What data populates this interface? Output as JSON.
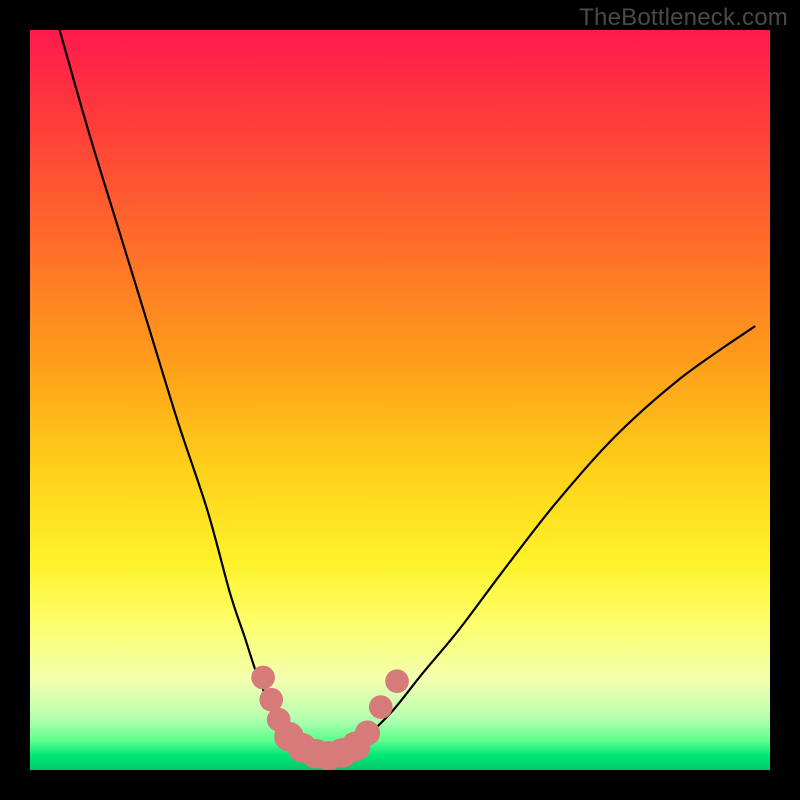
{
  "watermark": "TheBottleneck.com",
  "chart_data": {
    "type": "line",
    "title": "",
    "xlabel": "",
    "ylabel": "",
    "xlim": [
      0,
      100
    ],
    "ylim": [
      0,
      100
    ],
    "gradient_bands": [
      {
        "pos": 0,
        "color": "#ff1a4d"
      },
      {
        "pos": 12,
        "color": "#ff3b3b"
      },
      {
        "pos": 28,
        "color": "#ff6a2a"
      },
      {
        "pos": 45,
        "color": "#ff9e1a"
      },
      {
        "pos": 60,
        "color": "#ffd21a"
      },
      {
        "pos": 72,
        "color": "#fff22a"
      },
      {
        "pos": 80,
        "color": "#fdff6a"
      },
      {
        "pos": 88,
        "color": "#f2ffb0"
      },
      {
        "pos": 93,
        "color": "#b6ffb0"
      },
      {
        "pos": 96,
        "color": "#5eff90"
      },
      {
        "pos": 98,
        "color": "#00e878"
      },
      {
        "pos": 100,
        "color": "#00c86a"
      }
    ],
    "series": [
      {
        "name": "left-branch",
        "stroke": "#000000",
        "stroke_width": 2.2,
        "x": [
          4,
          8,
          12,
          16,
          20,
          24,
          27,
          29,
          31,
          33,
          35
        ],
        "y": [
          100,
          86,
          73,
          60,
          47,
          35,
          24,
          18,
          12,
          8,
          4
        ]
      },
      {
        "name": "right-branch",
        "stroke": "#000000",
        "stroke_width": 2.2,
        "x": [
          45,
          49,
          53,
          58,
          64,
          71,
          79,
          88,
          98
        ],
        "y": [
          4,
          8,
          13,
          19,
          27,
          36,
          45,
          53,
          60
        ]
      },
      {
        "name": "valley-floor",
        "stroke": "#000000",
        "stroke_width": 2.2,
        "x": [
          35,
          37,
          40,
          43,
          45
        ],
        "y": [
          4,
          2.2,
          1.6,
          2.2,
          4
        ]
      }
    ],
    "markers": [
      {
        "name": "valley-marker-chain",
        "color": "#d77a7a",
        "points": [
          {
            "x": 31.5,
            "y": 12.5,
            "r": 1.6
          },
          {
            "x": 32.6,
            "y": 9.5,
            "r": 1.6
          },
          {
            "x": 33.6,
            "y": 6.8,
            "r": 1.6
          },
          {
            "x": 35.0,
            "y": 4.5,
            "r": 2.0
          },
          {
            "x": 36.8,
            "y": 3.0,
            "r": 2.0
          },
          {
            "x": 38.6,
            "y": 2.2,
            "r": 2.0
          },
          {
            "x": 40.4,
            "y": 1.9,
            "r": 2.0
          },
          {
            "x": 42.2,
            "y": 2.3,
            "r": 2.0
          },
          {
            "x": 44.0,
            "y": 3.2,
            "r": 2.0
          },
          {
            "x": 45.6,
            "y": 5.0,
            "r": 1.7
          },
          {
            "x": 47.4,
            "y": 8.5,
            "r": 1.6
          }
        ]
      },
      {
        "name": "valley-marker-isolated",
        "color": "#d77a7a",
        "points": [
          {
            "x": 49.6,
            "y": 12.0,
            "r": 1.6
          }
        ]
      }
    ]
  }
}
